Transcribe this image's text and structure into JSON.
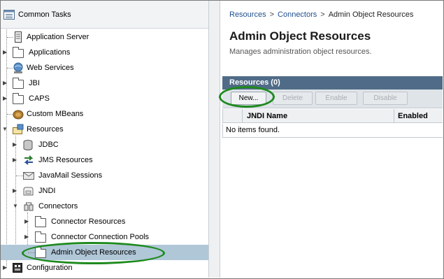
{
  "left_pane": {
    "header": {
      "label": "Common Tasks",
      "icon": "list-icon"
    },
    "tree": [
      {
        "label": "Application Server",
        "icon": "server-icon",
        "level": 0,
        "expand": "none"
      },
      {
        "label": "Applications",
        "icon": "folder-icon",
        "level": 0,
        "expand": "collapsed"
      },
      {
        "label": "Web Services",
        "icon": "web-services-icon",
        "level": 0,
        "expand": "none"
      },
      {
        "label": "JBI",
        "icon": "folder-icon",
        "level": 0,
        "expand": "collapsed"
      },
      {
        "label": "CAPS",
        "icon": "folder-icon",
        "level": 0,
        "expand": "collapsed"
      },
      {
        "label": "Custom MBeans",
        "icon": "mbean-icon",
        "level": 0,
        "expand": "none"
      },
      {
        "label": "Resources",
        "icon": "resources-icon",
        "level": 0,
        "expand": "expanded"
      },
      {
        "label": "JDBC",
        "icon": "database-icon",
        "level": 1,
        "expand": "collapsed"
      },
      {
        "label": "JMS Resources",
        "icon": "jms-icon",
        "level": 1,
        "expand": "collapsed"
      },
      {
        "label": "JavaMail Sessions",
        "icon": "mail-icon",
        "level": 1,
        "expand": "none"
      },
      {
        "label": "JNDI",
        "icon": "jndi-icon",
        "level": 1,
        "expand": "collapsed"
      },
      {
        "label": "Connectors",
        "icon": "connectors-icon",
        "level": 1,
        "expand": "expanded"
      },
      {
        "label": "Connector Resources",
        "icon": "folder-icon",
        "level": 2,
        "expand": "collapsed"
      },
      {
        "label": "Connector Connection Pools",
        "icon": "folder-icon",
        "level": 2,
        "expand": "collapsed"
      },
      {
        "label": "Admin Object Resources",
        "icon": "folder-icon",
        "level": 2,
        "expand": "none",
        "selected": true
      },
      {
        "label": "Configuration",
        "icon": "configuration-icon",
        "level": 0,
        "expand": "collapsed"
      }
    ]
  },
  "breadcrumb": {
    "items": [
      "Resources",
      "Connectors"
    ],
    "separator": ">",
    "current": "Admin Object Resources"
  },
  "page": {
    "title": "Admin Object Resources",
    "description": "Manages administration object resources."
  },
  "table": {
    "title": "Resources (0)",
    "buttons": [
      {
        "label": "New...",
        "enabled": true
      },
      {
        "label": "Delete",
        "enabled": false
      },
      {
        "label": "Enable",
        "enabled": false
      },
      {
        "label": "Disable",
        "enabled": false
      }
    ],
    "columns": [
      "JNDI Name",
      "Enabled"
    ],
    "empty_message": "No items found."
  },
  "colors": {
    "selection": "#b0c7d8",
    "table_title_bg": "#4f6b87",
    "link": "#1f4f8e",
    "highlight": "#1e8a1e"
  }
}
